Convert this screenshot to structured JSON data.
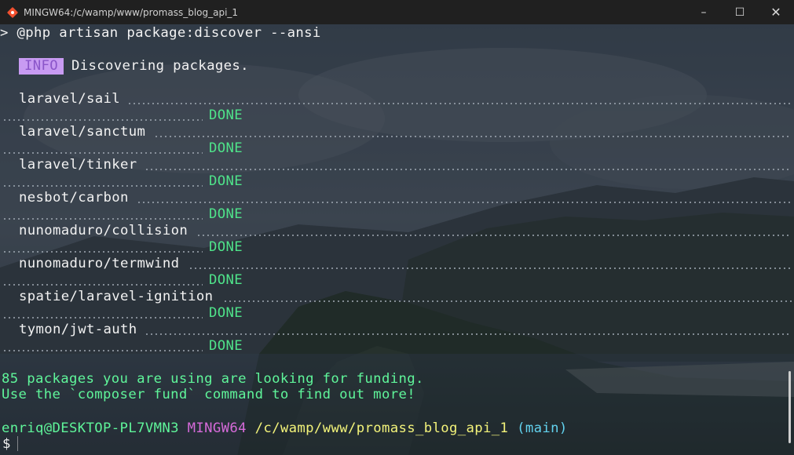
{
  "window": {
    "title": "MINGW64:/c/wamp/www/promass_blog_api_1",
    "app_icon": "git-bash-icon",
    "controls": {
      "minimize": "–",
      "maximize": "☐",
      "close": "✕"
    }
  },
  "terminal": {
    "command_line": "> @php artisan package:discover --ansi",
    "info_badge": "INFO",
    "info_text": "Discovering packages.",
    "status_word": "DONE",
    "packages": [
      "laravel/sail",
      "laravel/sanctum",
      "laravel/tinker",
      "nesbot/carbon",
      "nunomaduro/collision",
      "nunomaduro/termwind",
      "spatie/laravel-ignition",
      "tymon/jwt-auth"
    ],
    "funding_line_1": "85 packages you are using are looking for funding.",
    "funding_line_2": "Use the `composer fund` command to find out more!",
    "prompt": {
      "user_host": "enriq@DESKTOP-PL7VMN3",
      "shell": "MINGW64",
      "path": "/c/wamp/www/promass_blog_api_1",
      "branch": "(main)",
      "symbol": "$"
    },
    "colors": {
      "green": "#5ff59a",
      "magenta": "#d66ad9",
      "yellow": "#f3f37a",
      "cyan": "#62d2ee",
      "badge_bg": "#c89bf2"
    }
  }
}
